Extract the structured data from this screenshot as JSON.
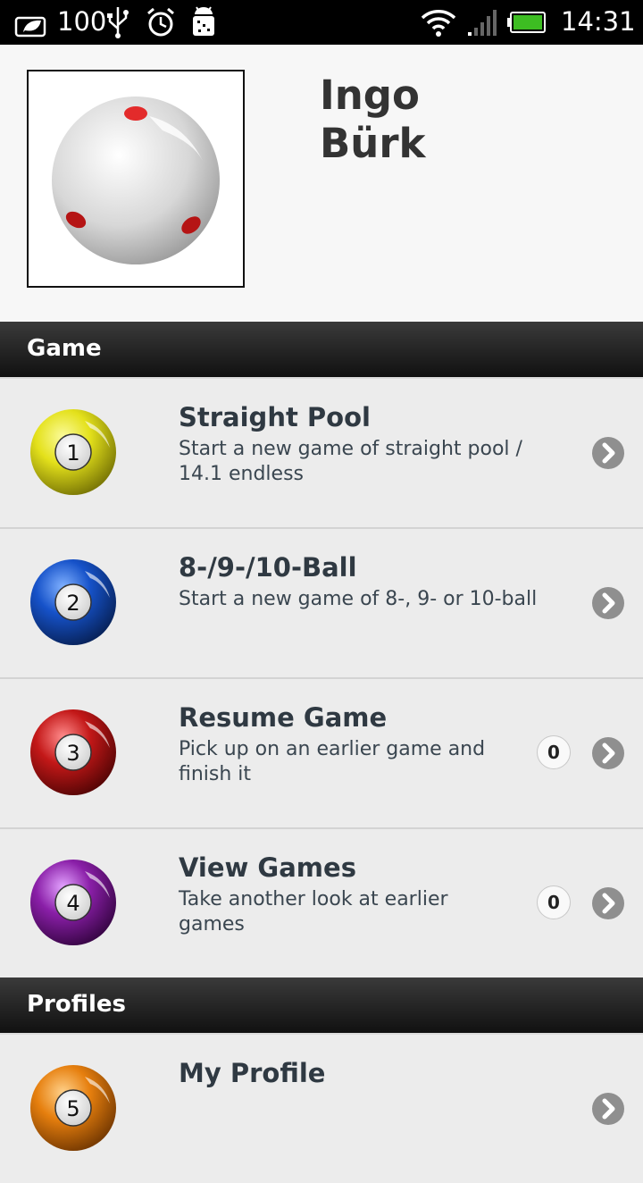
{
  "status_bar": {
    "battery_level": "100",
    "time": "14:31",
    "icons": [
      "leaf-battery-saver-icon",
      "usb-icon",
      "alarm-icon",
      "android-debug-icon",
      "wifi-icon",
      "signal-icon",
      "battery-icon"
    ]
  },
  "profile": {
    "first_name": "Ingo",
    "last_name": "Bürk",
    "avatar": "cue-ball-avatar"
  },
  "sections": {
    "game": "Game",
    "profiles": "Profiles"
  },
  "rows": {
    "straight_pool": {
      "number": "1",
      "title": "Straight Pool",
      "description": "Start a new game of straight pool / 14.1 endless",
      "color": "#e6e31a"
    },
    "ball_game": {
      "number": "2",
      "title": "8-/9-/10-Ball",
      "description": "Start a new game of 8-, 9- or 10-ball",
      "color": "#1750c8"
    },
    "resume_game": {
      "number": "3",
      "title": "Resume Game",
      "description": "Pick up on an earlier game and finish it",
      "count": "0",
      "color": "#c21818"
    },
    "view_games": {
      "number": "4",
      "title": "View Games",
      "description": "Take another look at earlier games",
      "count": "0",
      "color": "#8a1fa8"
    },
    "my_profile": {
      "number": "5",
      "title": "My Profile",
      "color": "#e8800f"
    }
  },
  "colors": {
    "header_bar": "#1a1a1a",
    "list_background": "#ececec",
    "title_text": "#2f3942"
  }
}
